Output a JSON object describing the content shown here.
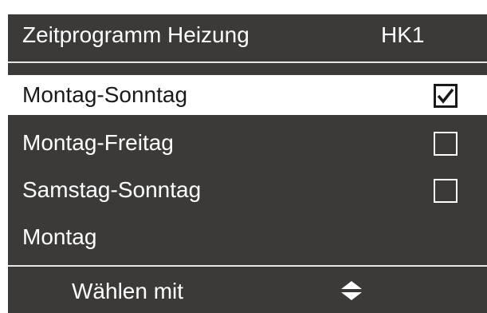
{
  "header": {
    "title": "Zeitprogramm Heizung",
    "circuit": "HK1"
  },
  "options": [
    {
      "label": "Montag-Sonntag",
      "checked": true,
      "selected": true
    },
    {
      "label": "Montag-Freitag",
      "checked": false,
      "selected": false
    },
    {
      "label": "Samstag-Sonntag",
      "checked": false,
      "selected": false
    },
    {
      "label": "Montag",
      "checked": false,
      "selected": false
    }
  ],
  "footer": {
    "hint": "Wählen mit",
    "icon": "up-down-arrow-icon"
  },
  "colors": {
    "panel_bg": "#3b3a38",
    "text_light": "#ffffff",
    "selected_bg": "#ffffff",
    "selected_text": "#1a1a1a"
  }
}
